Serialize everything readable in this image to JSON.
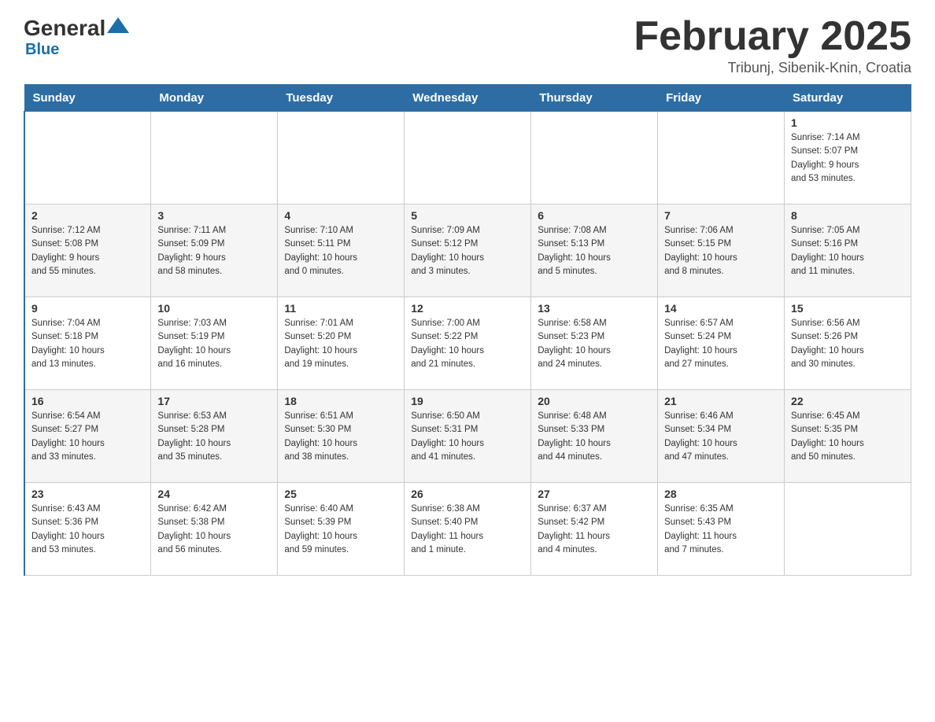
{
  "header": {
    "logo": {
      "general": "General",
      "blue": "Blue"
    },
    "title": "February 2025",
    "location": "Tribunj, Sibenik-Knin, Croatia"
  },
  "weekdays": [
    "Sunday",
    "Monday",
    "Tuesday",
    "Wednesday",
    "Thursday",
    "Friday",
    "Saturday"
  ],
  "weeks": [
    {
      "days": [
        {
          "number": "",
          "info": ""
        },
        {
          "number": "",
          "info": ""
        },
        {
          "number": "",
          "info": ""
        },
        {
          "number": "",
          "info": ""
        },
        {
          "number": "",
          "info": ""
        },
        {
          "number": "",
          "info": ""
        },
        {
          "number": "1",
          "info": "Sunrise: 7:14 AM\nSunset: 5:07 PM\nDaylight: 9 hours\nand 53 minutes."
        }
      ]
    },
    {
      "days": [
        {
          "number": "2",
          "info": "Sunrise: 7:12 AM\nSunset: 5:08 PM\nDaylight: 9 hours\nand 55 minutes."
        },
        {
          "number": "3",
          "info": "Sunrise: 7:11 AM\nSunset: 5:09 PM\nDaylight: 9 hours\nand 58 minutes."
        },
        {
          "number": "4",
          "info": "Sunrise: 7:10 AM\nSunset: 5:11 PM\nDaylight: 10 hours\nand 0 minutes."
        },
        {
          "number": "5",
          "info": "Sunrise: 7:09 AM\nSunset: 5:12 PM\nDaylight: 10 hours\nand 3 minutes."
        },
        {
          "number": "6",
          "info": "Sunrise: 7:08 AM\nSunset: 5:13 PM\nDaylight: 10 hours\nand 5 minutes."
        },
        {
          "number": "7",
          "info": "Sunrise: 7:06 AM\nSunset: 5:15 PM\nDaylight: 10 hours\nand 8 minutes."
        },
        {
          "number": "8",
          "info": "Sunrise: 7:05 AM\nSunset: 5:16 PM\nDaylight: 10 hours\nand 11 minutes."
        }
      ]
    },
    {
      "days": [
        {
          "number": "9",
          "info": "Sunrise: 7:04 AM\nSunset: 5:18 PM\nDaylight: 10 hours\nand 13 minutes."
        },
        {
          "number": "10",
          "info": "Sunrise: 7:03 AM\nSunset: 5:19 PM\nDaylight: 10 hours\nand 16 minutes."
        },
        {
          "number": "11",
          "info": "Sunrise: 7:01 AM\nSunset: 5:20 PM\nDaylight: 10 hours\nand 19 minutes."
        },
        {
          "number": "12",
          "info": "Sunrise: 7:00 AM\nSunset: 5:22 PM\nDaylight: 10 hours\nand 21 minutes."
        },
        {
          "number": "13",
          "info": "Sunrise: 6:58 AM\nSunset: 5:23 PM\nDaylight: 10 hours\nand 24 minutes."
        },
        {
          "number": "14",
          "info": "Sunrise: 6:57 AM\nSunset: 5:24 PM\nDaylight: 10 hours\nand 27 minutes."
        },
        {
          "number": "15",
          "info": "Sunrise: 6:56 AM\nSunset: 5:26 PM\nDaylight: 10 hours\nand 30 minutes."
        }
      ]
    },
    {
      "days": [
        {
          "number": "16",
          "info": "Sunrise: 6:54 AM\nSunset: 5:27 PM\nDaylight: 10 hours\nand 33 minutes."
        },
        {
          "number": "17",
          "info": "Sunrise: 6:53 AM\nSunset: 5:28 PM\nDaylight: 10 hours\nand 35 minutes."
        },
        {
          "number": "18",
          "info": "Sunrise: 6:51 AM\nSunset: 5:30 PM\nDaylight: 10 hours\nand 38 minutes."
        },
        {
          "number": "19",
          "info": "Sunrise: 6:50 AM\nSunset: 5:31 PM\nDaylight: 10 hours\nand 41 minutes."
        },
        {
          "number": "20",
          "info": "Sunrise: 6:48 AM\nSunset: 5:33 PM\nDaylight: 10 hours\nand 44 minutes."
        },
        {
          "number": "21",
          "info": "Sunrise: 6:46 AM\nSunset: 5:34 PM\nDaylight: 10 hours\nand 47 minutes."
        },
        {
          "number": "22",
          "info": "Sunrise: 6:45 AM\nSunset: 5:35 PM\nDaylight: 10 hours\nand 50 minutes."
        }
      ]
    },
    {
      "days": [
        {
          "number": "23",
          "info": "Sunrise: 6:43 AM\nSunset: 5:36 PM\nDaylight: 10 hours\nand 53 minutes."
        },
        {
          "number": "24",
          "info": "Sunrise: 6:42 AM\nSunset: 5:38 PM\nDaylight: 10 hours\nand 56 minutes."
        },
        {
          "number": "25",
          "info": "Sunrise: 6:40 AM\nSunset: 5:39 PM\nDaylight: 10 hours\nand 59 minutes."
        },
        {
          "number": "26",
          "info": "Sunrise: 6:38 AM\nSunset: 5:40 PM\nDaylight: 11 hours\nand 1 minute."
        },
        {
          "number": "27",
          "info": "Sunrise: 6:37 AM\nSunset: 5:42 PM\nDaylight: 11 hours\nand 4 minutes."
        },
        {
          "number": "28",
          "info": "Sunrise: 6:35 AM\nSunset: 5:43 PM\nDaylight: 11 hours\nand 7 minutes."
        },
        {
          "number": "",
          "info": ""
        }
      ]
    }
  ]
}
